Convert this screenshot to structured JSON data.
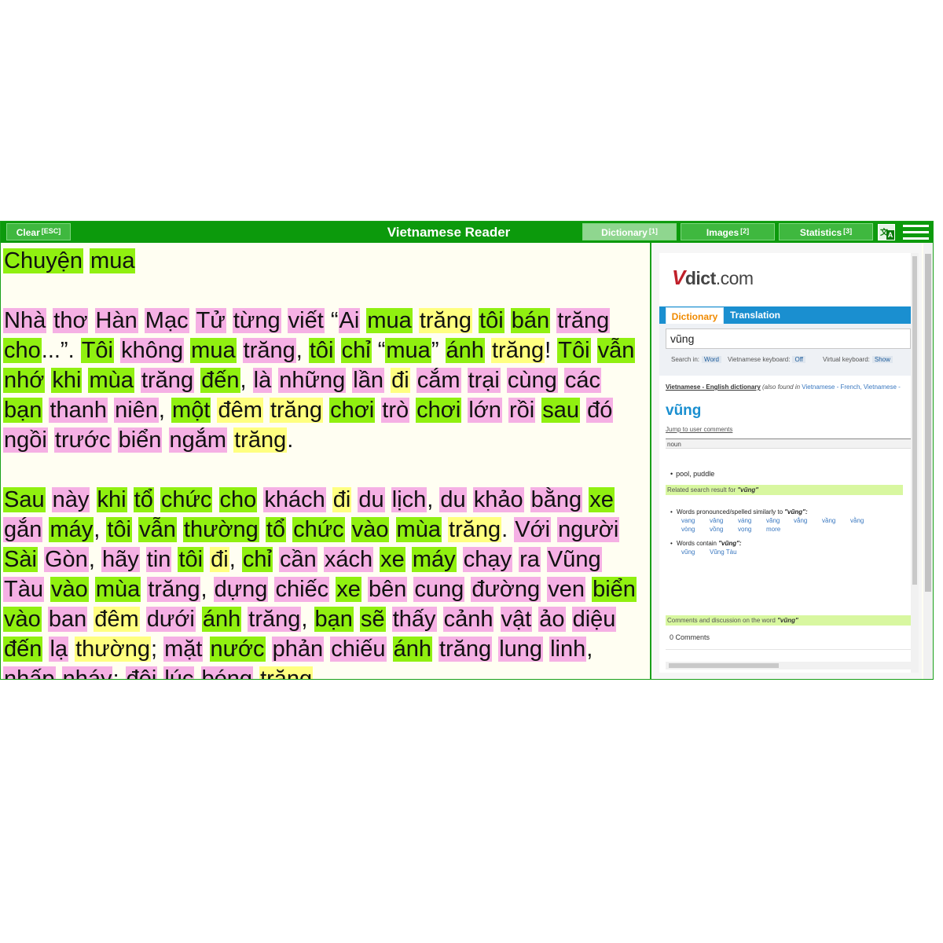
{
  "toolbar": {
    "clear_label": "Clear",
    "clear_shortcut": "[ESC]",
    "title": "Vietnamese Reader",
    "tabs": [
      {
        "label": "Dictionary",
        "shortcut": "[1]"
      },
      {
        "label": "Images",
        "shortcut": "[2]"
      },
      {
        "label": "Statistics",
        "shortcut": "[3]"
      }
    ],
    "translate_glyph_1": "文",
    "translate_glyph_2": "A"
  },
  "reading": {
    "title": [
      [
        "Chuyện",
        "g"
      ],
      [
        "mua",
        "g"
      ]
    ],
    "paragraphs": [
      [
        [
          "Nhà",
          "p"
        ],
        [
          "thơ",
          "p"
        ],
        [
          "Hàn",
          "p"
        ],
        [
          "Mạc",
          "p"
        ],
        [
          "Tử",
          "p"
        ],
        [
          "từng",
          "p"
        ],
        [
          "viết",
          "p"
        ],
        [
          "“",
          ""
        ],
        [
          "Ai",
          "p"
        ],
        [
          "mua",
          "g"
        ],
        [
          "trăng",
          "y"
        ],
        [
          "tôi",
          "g"
        ],
        [
          "bán",
          "g"
        ],
        [
          "trăng",
          "p"
        ],
        [
          "cho",
          "g"
        ],
        [
          "...”.",
          ""
        ],
        [
          "Tôi",
          "g"
        ],
        [
          "không",
          "p"
        ],
        [
          "mua",
          "g"
        ],
        [
          "trăng",
          "p"
        ],
        [
          ",",
          ""
        ],
        [
          "tôi",
          "g"
        ],
        [
          "chỉ",
          "g"
        ],
        [
          "“",
          ""
        ],
        [
          "mua",
          "g"
        ],
        [
          "”",
          ""
        ],
        [
          "ánh",
          "g"
        ],
        [
          "trăng",
          "y"
        ],
        [
          "!",
          ""
        ],
        [
          "Tôi",
          "g"
        ],
        [
          "vẫn",
          "g"
        ],
        [
          "nhớ",
          "g"
        ],
        [
          "khi",
          "g"
        ],
        [
          "mùa",
          "g"
        ],
        [
          "trăng",
          "p"
        ],
        [
          "đến",
          "g"
        ],
        [
          ",",
          ""
        ],
        [
          "là",
          "p"
        ],
        [
          "những",
          "p"
        ],
        [
          "lần",
          "p"
        ],
        [
          "đi",
          "y"
        ],
        [
          "cắm",
          "p"
        ],
        [
          "trại",
          "p"
        ],
        [
          "cùng",
          "p"
        ],
        [
          "các",
          "p"
        ],
        [
          "bạn",
          "g"
        ],
        [
          "thanh",
          "p"
        ],
        [
          "niên",
          "p"
        ],
        [
          ",",
          ""
        ],
        [
          "một",
          "g"
        ],
        [
          "đêm",
          "y"
        ],
        [
          "trăng",
          "y"
        ],
        [
          "chơi",
          "g"
        ],
        [
          "trò",
          "p"
        ],
        [
          "chơi",
          "g"
        ],
        [
          "lớn",
          "p"
        ],
        [
          "rồi",
          "p"
        ],
        [
          "sau",
          "g"
        ],
        [
          "đó",
          "p"
        ],
        [
          "ngồi",
          "p"
        ],
        [
          "trước",
          "p"
        ],
        [
          "biển",
          "p"
        ],
        [
          "ngắm",
          "p"
        ],
        [
          "trăng",
          "y"
        ],
        [
          ".",
          ""
        ]
      ],
      [
        [
          "Sau",
          "g"
        ],
        [
          "này",
          "p"
        ],
        [
          "khi",
          "g"
        ],
        [
          "tổ",
          "g"
        ],
        [
          "chức",
          "g"
        ],
        [
          "cho",
          "g"
        ],
        [
          "khách",
          "p"
        ],
        [
          "đi",
          "y"
        ],
        [
          "du",
          "p"
        ],
        [
          "lịch",
          "p"
        ],
        [
          ",",
          ""
        ],
        [
          "du",
          "p"
        ],
        [
          "khảo",
          "p"
        ],
        [
          "bằng",
          "p"
        ],
        [
          "xe",
          "g"
        ],
        [
          "gắn",
          "p"
        ],
        [
          "máy",
          "g"
        ],
        [
          ",",
          ""
        ],
        [
          "tôi",
          "g"
        ],
        [
          "vẫn",
          "g"
        ],
        [
          "thường",
          "g"
        ],
        [
          "tổ",
          "g"
        ],
        [
          "chức",
          "g"
        ],
        [
          "vào",
          "g"
        ],
        [
          "mùa",
          "g"
        ],
        [
          "trăng",
          "y"
        ],
        [
          ".",
          ""
        ],
        [
          "Với",
          "p"
        ],
        [
          "người",
          "p"
        ],
        [
          "Sài",
          "g"
        ],
        [
          "Gòn",
          "p"
        ],
        [
          ",",
          ""
        ],
        [
          "hãy",
          "p"
        ],
        [
          "tin",
          "p"
        ],
        [
          "tôi",
          "g"
        ],
        [
          "đi",
          "y"
        ],
        [
          ",",
          ""
        ],
        [
          "chỉ",
          "g"
        ],
        [
          "cần",
          "p"
        ],
        [
          "xách",
          "p"
        ],
        [
          "xe",
          "g"
        ],
        [
          "máy",
          "g"
        ],
        [
          "chạy",
          "p"
        ],
        [
          "ra",
          "p"
        ],
        [
          "Vũng",
          "p"
        ],
        [
          "Tàu",
          "p"
        ],
        [
          "vào",
          "g"
        ],
        [
          "mùa",
          "g"
        ],
        [
          "trăng",
          "p"
        ],
        [
          ",",
          ""
        ],
        [
          "dựng",
          "p"
        ],
        [
          "chiếc",
          "p"
        ],
        [
          "xe",
          "g"
        ],
        [
          "bên",
          "p"
        ],
        [
          "cung",
          "p"
        ],
        [
          "đường",
          "p"
        ],
        [
          "ven",
          "p"
        ],
        [
          "biển",
          "g"
        ],
        [
          "vào",
          "g"
        ],
        [
          "ban",
          "p"
        ],
        [
          "đêm",
          "y"
        ],
        [
          "dưới",
          "p"
        ],
        [
          "ánh",
          "g"
        ],
        [
          "trăng",
          "p"
        ],
        [
          ",",
          ""
        ],
        [
          "bạn",
          "g"
        ],
        [
          "sẽ",
          "g"
        ],
        [
          "thấy",
          "p"
        ],
        [
          "cảnh",
          "p"
        ],
        [
          "vật",
          "p"
        ],
        [
          "ảo",
          "p"
        ],
        [
          "diệu",
          "p"
        ],
        [
          "đến",
          "g"
        ],
        [
          "lạ",
          "p"
        ],
        [
          "thường",
          "y"
        ],
        [
          ";",
          ""
        ],
        [
          "mặt",
          "p"
        ],
        [
          "nước",
          "g"
        ],
        [
          "phản",
          "p"
        ],
        [
          "chiếu",
          "p"
        ],
        [
          "ánh",
          "g"
        ],
        [
          "trăng",
          "p"
        ],
        [
          "lung",
          "p"
        ],
        [
          "linh",
          "p"
        ],
        [
          ",",
          ""
        ],
        [
          "nhấp",
          "p"
        ],
        [
          "nháy",
          "p"
        ],
        [
          ";",
          ""
        ],
        [
          "đôi",
          "p"
        ],
        [
          "lúc",
          "p"
        ],
        [
          "bóng",
          "p"
        ],
        [
          "trăng",
          "y"
        ]
      ]
    ]
  },
  "dictionary": {
    "logo_v": "V",
    "logo_dict": "dict",
    "logo_com": ".com",
    "tab_dictionary": "Dictionary",
    "tab_translation": "Translation",
    "search_value": "vũng",
    "search_in_label": "Search in:",
    "search_in_value": "Word",
    "vn_keyboard_label": "Vietnamese keyboard:",
    "vn_keyboard_value": "Off",
    "virtual_keyboard_label": "Virtual keyboard:",
    "virtual_keyboard_value": "Show",
    "source_title": "Vietnamese - English dictionary",
    "source_also": "(also found in",
    "source_links": "Vietnamese - French, Vietnamese -",
    "headword": "vũng",
    "jump_link": "Jump to user comments",
    "pos": "noun",
    "meaning": "pool, puddle",
    "related_label": "Related search result for",
    "related_word": "\"vũng\"",
    "similar_label": "Words pronounced/spelled similarly to",
    "similar_word": "\"vũng\":",
    "similar_words": [
      "vang",
      "vâng",
      "váng",
      "vãng",
      "vắng",
      "vầng",
      "vằng",
      "vòng",
      "vồng",
      "vọng",
      "more"
    ],
    "contain_label": "Words contain",
    "contain_word": "\"vũng\":",
    "contain_words": [
      "vũng",
      "Vũng Tàu"
    ],
    "comments_label": "Comments and discussion on the word",
    "comments_word": "\"vũng\"",
    "comments_count": "0 Comments",
    "bullet": "•"
  },
  "colors": {
    "topbar": "#0c9a0c",
    "known": "#90f010",
    "unknown": "#f5b0e4",
    "learning": "#ffff80",
    "reading_bg": "#fffef2"
  }
}
